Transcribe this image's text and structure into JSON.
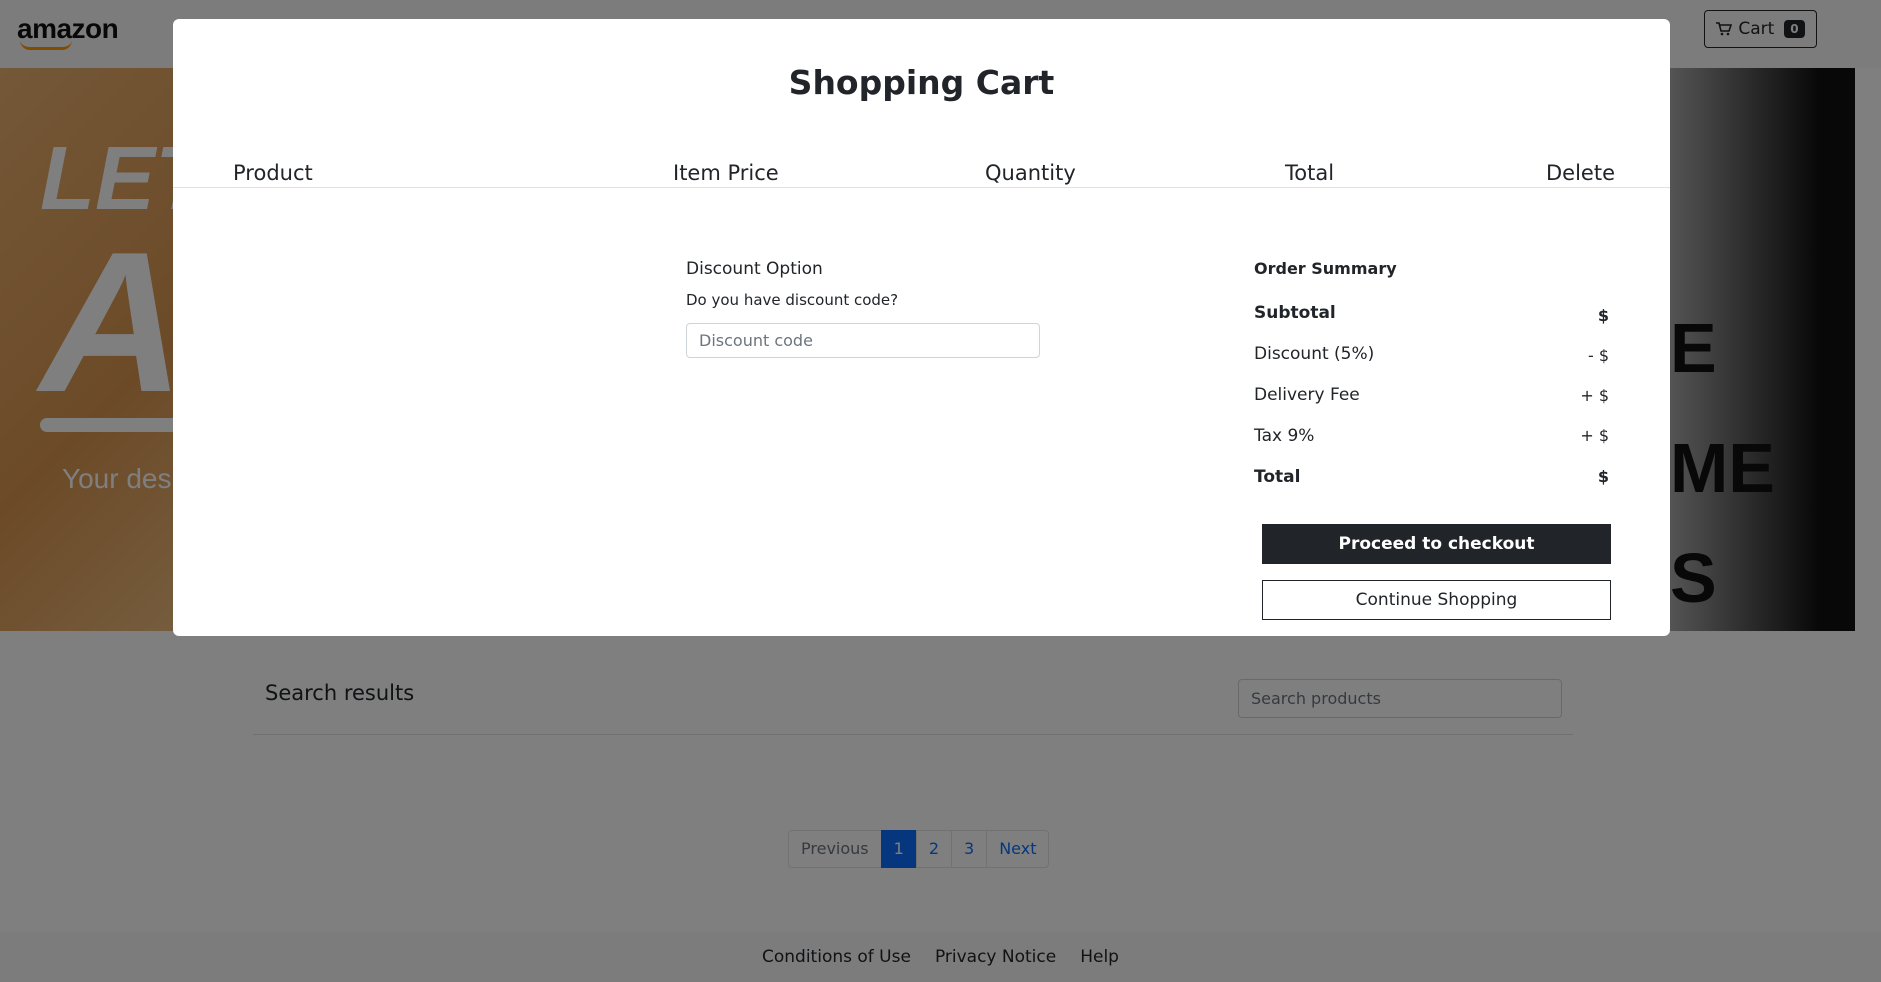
{
  "nav": {
    "logo": "amazon",
    "cart_label": "Cart",
    "cart_count": "0"
  },
  "banner": {
    "left_text_top": "LET",
    "left_text_big": "A",
    "left_sub": "Your desi",
    "right_letters": [
      "E",
      "ME",
      "S"
    ]
  },
  "search": {
    "title": "Search results",
    "placeholder": "Search products"
  },
  "pagination": {
    "previous": "Previous",
    "pages": [
      "1",
      "2",
      "3"
    ],
    "next": "Next",
    "active_page": "1"
  },
  "footer": {
    "links": [
      "Conditions of Use",
      "Privacy Notice",
      "Help"
    ]
  },
  "modal": {
    "title": "Shopping Cart",
    "columns": {
      "product": "Product",
      "item_price": "Item Price",
      "quantity": "Quantity",
      "total": "Total",
      "delete": "Delete"
    },
    "discount": {
      "title": "Discount Option",
      "question": "Do you have discount code?",
      "placeholder": "Discount code"
    },
    "summary": {
      "title": "Order Summary",
      "subtotal_label": "Subtotal",
      "subtotal_value": "$",
      "discount_label": "Discount (5%)",
      "discount_value": "- $",
      "delivery_label": "Delivery Fee",
      "delivery_value": "+ $",
      "tax_label": "Tax 9%",
      "tax_value": "+ $",
      "total_label": "Total",
      "total_value": "$"
    },
    "checkout_label": "Proceed to checkout",
    "continue_label": "Continue Shopping"
  },
  "colors": {
    "dark": "#212529",
    "link_blue": "#0d6efd",
    "backdrop": "rgba(0,0,0,0.5)"
  }
}
